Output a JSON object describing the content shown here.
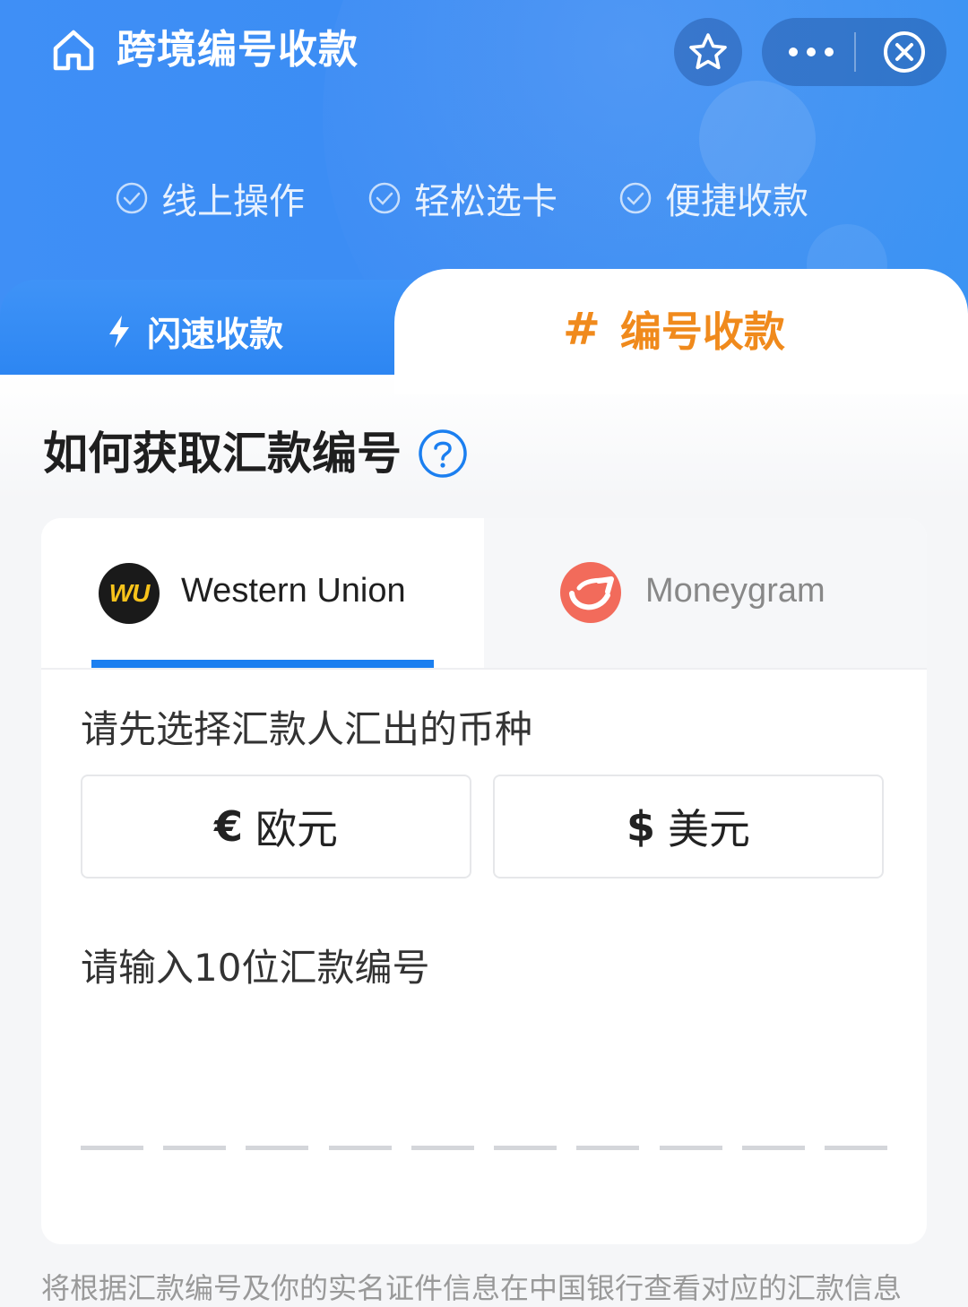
{
  "header": {
    "title": "跨境编号收款"
  },
  "features": [
    {
      "label": "线上操作"
    },
    {
      "label": "轻松选卡"
    },
    {
      "label": "便捷收款"
    }
  ],
  "tabs": {
    "flash": {
      "label": "闪速收款"
    },
    "number": {
      "hash": "#",
      "label": "编号收款"
    }
  },
  "section": {
    "title": "如何获取汇款编号"
  },
  "providers": {
    "western_union": {
      "logo_text": "WU",
      "name": "Western Union"
    },
    "moneygram": {
      "name": "Moneygram"
    }
  },
  "currency": {
    "label": "请先选择汇款人汇出的币种",
    "options": [
      {
        "symbol": "€",
        "label": "欧元"
      },
      {
        "symbol": "$",
        "label": "美元"
      }
    ]
  },
  "number_input": {
    "label": "请输入10位汇款编号",
    "digit_count": 10
  },
  "footer": {
    "text": "将根据汇款编号及你的实名证件信息在中国银行查看对应的汇款信息"
  },
  "colors": {
    "brand_blue": "#2d86f2",
    "accent_orange": "#f08a1c",
    "wu_yellow": "#f8c31b",
    "moneygram_red": "#ef5a4c"
  }
}
